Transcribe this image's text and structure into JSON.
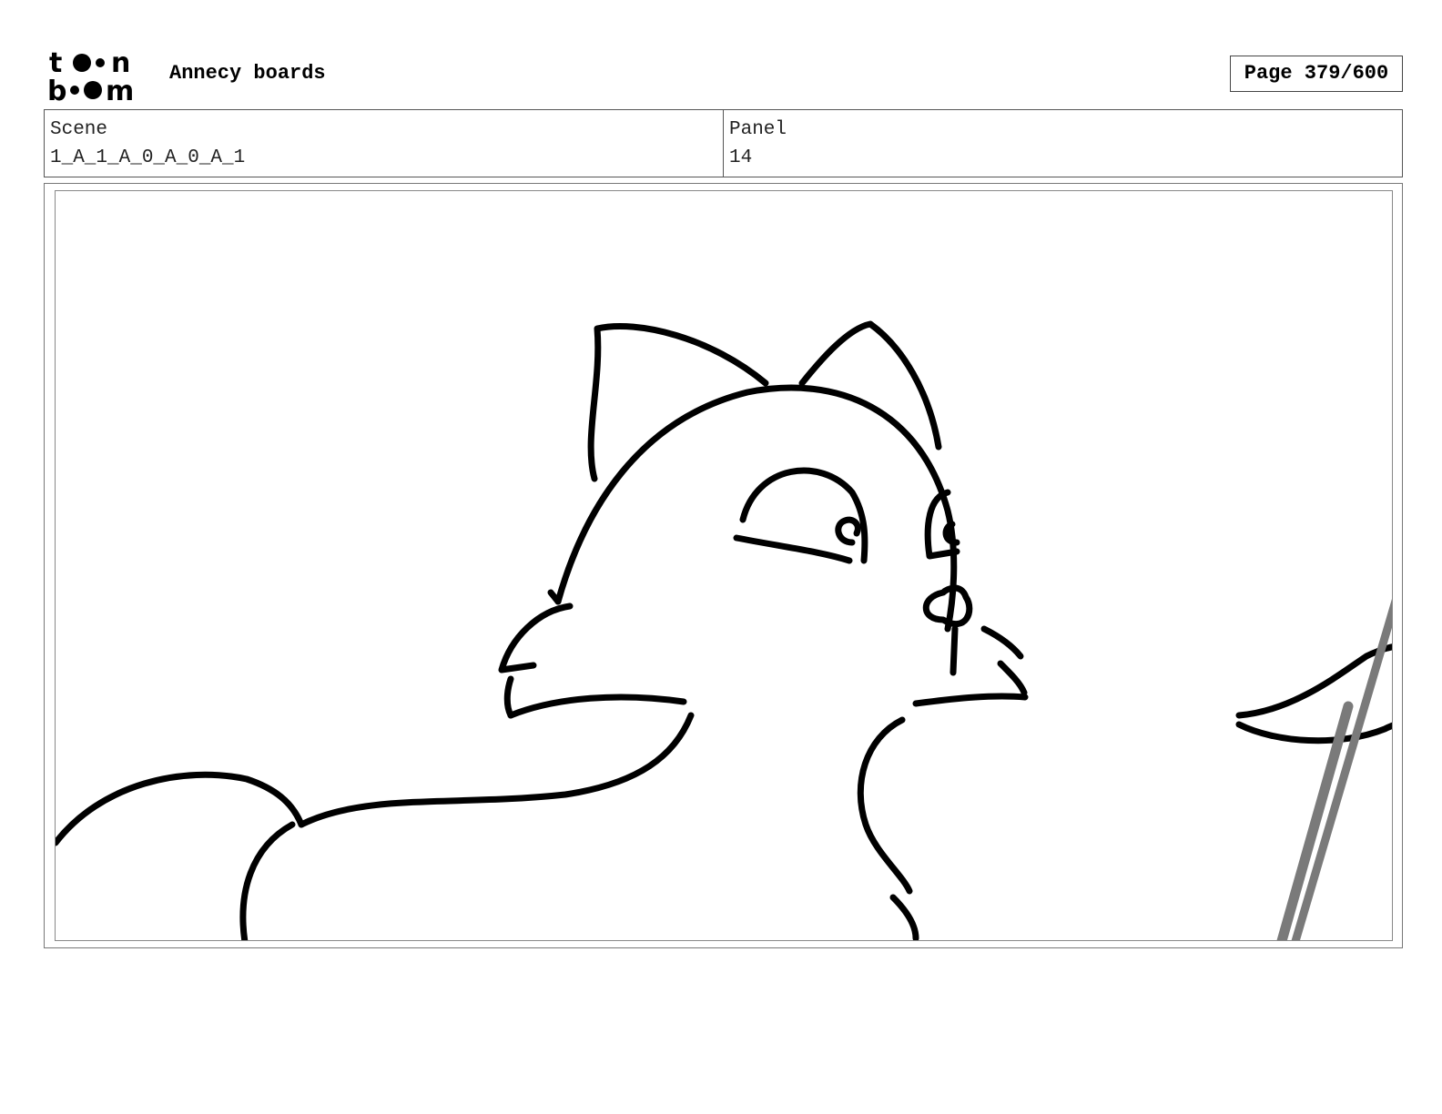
{
  "header": {
    "logo_text": "toon boom",
    "title": "Annecy boards",
    "page_label": "Page 379/600"
  },
  "info": {
    "scene_label": "Scene",
    "scene_value": "1_A_1_A_0_A_0_A_1",
    "panel_label": "Panel",
    "panel_value": "14"
  },
  "sketch": {
    "subject": "fox-character-sketch",
    "stroke_color": "#000000",
    "secondary_stroke_color": "#7a7a7a"
  }
}
